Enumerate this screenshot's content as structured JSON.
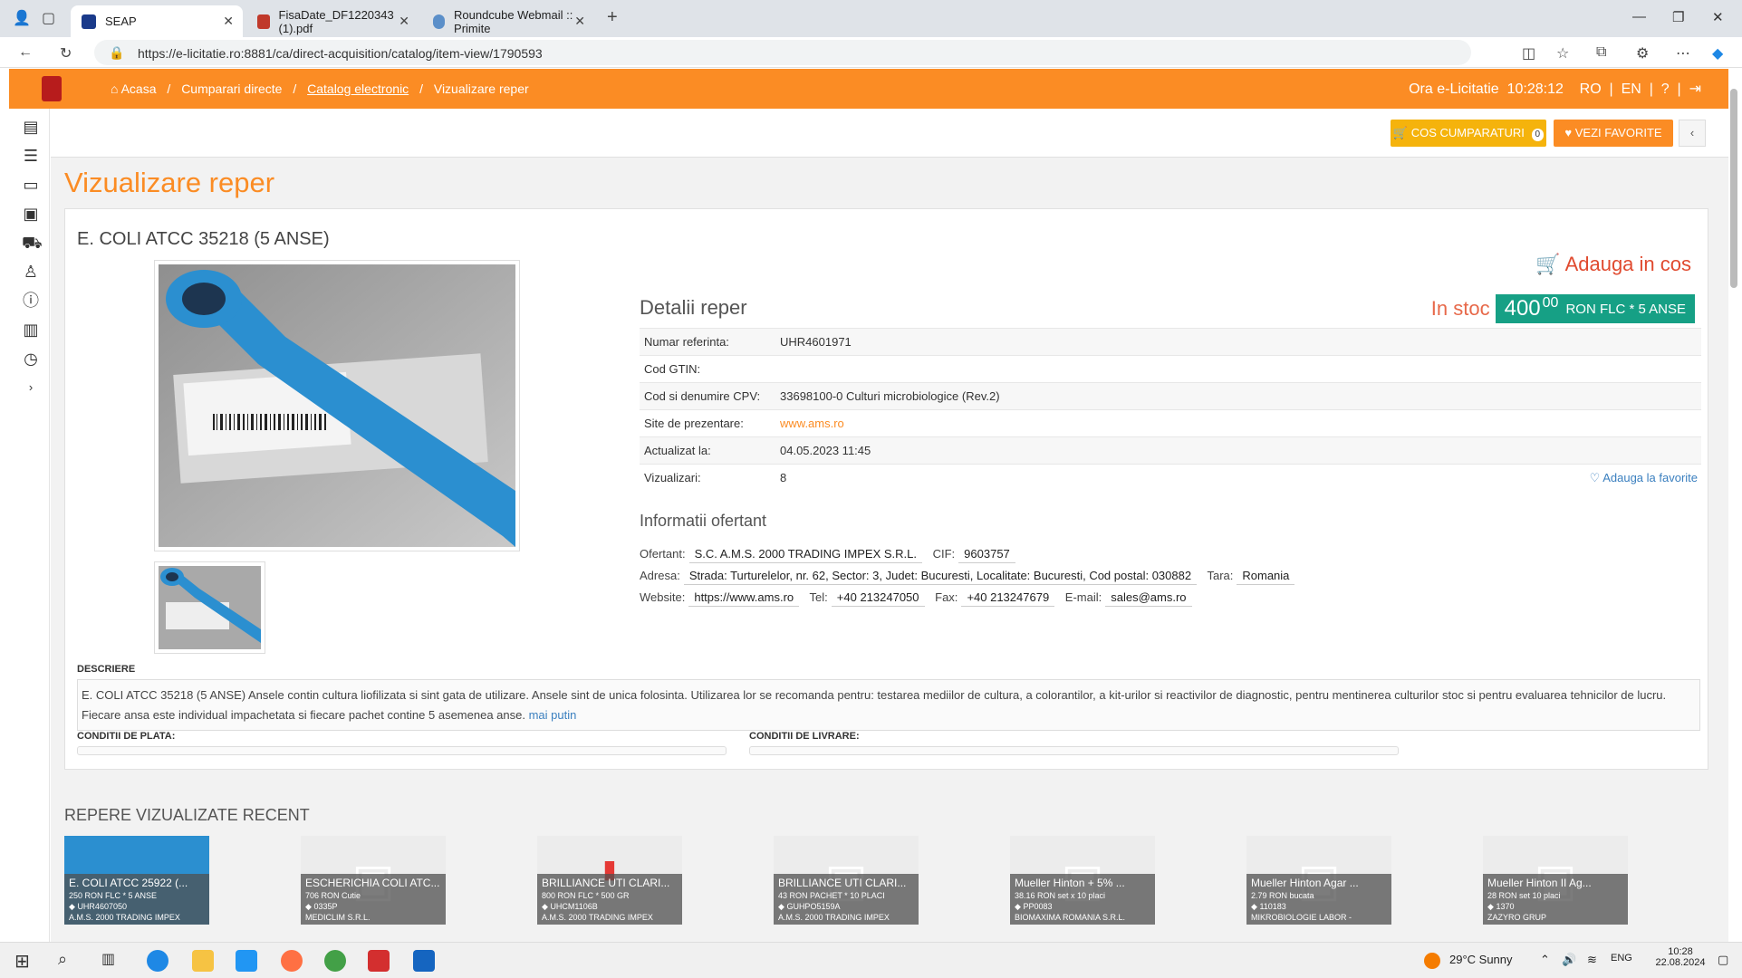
{
  "browser": {
    "tabs": [
      {
        "label": "SEAP"
      },
      {
        "label": "FisaDate_DF1220343 (1).pdf"
      },
      {
        "label": "Roundcube Webmail :: Primite"
      }
    ],
    "url": "https://e-licitatie.ro:8881/ca/direct-acquisition/catalog/item-view/1790593"
  },
  "topbar": {
    "breadcrumb": [
      "Acasa",
      "Cumparari directe",
      "Catalog electronic",
      "Vizualizare reper"
    ],
    "clock_label": "Ora e-Licitatie",
    "clock": "10:28:12",
    "lang_ro": "RO",
    "lang_en": "EN"
  },
  "actions": {
    "cart": "COS CUMPARATURI",
    "cart_count": "0",
    "favorites": "VEZI FAVORITE"
  },
  "page": {
    "title": "Vizualizare reper",
    "product_title": "E. COLI ATCC 35218 (5 ANSE)",
    "add_to_cart": "Adauga in cos",
    "details_heading": "Detalii reper",
    "stock_label": "In stoc",
    "price_int": "400",
    "price_dec": "00",
    "price_unit": "RON FLC * 5 ANSE",
    "details": [
      {
        "k": "Numar referinta:",
        "v": "UHR4601971"
      },
      {
        "k": "Cod GTIN:",
        "v": ""
      },
      {
        "k": "Cod si denumire CPV:",
        "v": "33698100-0 Culturi microbiologice (Rev.2)"
      },
      {
        "k": "Site de prezentare:",
        "v": "www.ams.ro"
      },
      {
        "k": "Actualizat la:",
        "v": "04.05.2023 11:45"
      },
      {
        "k": "Vizualizari:",
        "v": "8"
      }
    ],
    "add_fav": "Adauga la favorite",
    "offer_heading": "Informatii ofertant",
    "offer": {
      "ofertant_l": "Ofertant:",
      "ofertant": "S.C. A.M.S. 2000 TRADING IMPEX S.R.L.",
      "cif_l": "CIF:",
      "cif": "9603757",
      "adresa_l": "Adresa:",
      "adresa": "Strada: Turturelelor, nr. 62, Sector: 3, Judet: Bucuresti, Localitate: Bucuresti, Cod postal: 030882",
      "tara_l": "Tara:",
      "tara": "Romania",
      "web_l": "Website:",
      "web": "https://www.ams.ro",
      "tel_l": "Tel:",
      "tel": "+40 213247050",
      "fax_l": "Fax:",
      "fax": "+40 213247679",
      "email_l": "E-mail:",
      "email": "sales@ams.ro"
    },
    "desc_label": "DESCRIERE",
    "description": "E. COLI ATCC 35218 (5 ANSE) Ansele contin cultura liofilizata si sint gata de utilizare. Ansele sint de unica folosinta. Utilizarea lor se recomanda pentru: testarea mediilor de cultura, a colorantilor, a kit-urilor si reactivilor de diagnostic, pentru mentinerea culturilor stoc si pentru evaluarea tehnicilor de lucru. Fiecare ansa este individual impachetata si fiecare pachet contine 5 asemenea anse.",
    "less": "mai putin",
    "pay_label": "CONDITII DE PLATA:",
    "delivery_label": "CONDITII DE LIVRARE:",
    "recent_heading": "REPERE VIZUALIZATE RECENT"
  },
  "recent": [
    {
      "t": "E. COLI ATCC 25922 (...",
      "p": "250 RON FLC * 5 ANSE",
      "c": "UHR4607050",
      "s": "A.M.S. 2000 TRADING IMPEX"
    },
    {
      "t": "ESCHERICHIA COLI ATC...",
      "p": "706 RON Cutie",
      "c": "0335P",
      "s": "MEDICLIM S.R.L."
    },
    {
      "t": "BRILLIANCE UTI CLARI...",
      "p": "800 RON FLC * 500 GR",
      "c": "UHCM1106B",
      "s": "A.M.S. 2000 TRADING IMPEX"
    },
    {
      "t": "BRILLIANCE UTI CLARI...",
      "p": "43 RON PACHET * 10 PLACI",
      "c": "GUHPO5159A",
      "s": "A.M.S. 2000 TRADING IMPEX"
    },
    {
      "t": "Mueller Hinton + 5% ...",
      "p": "38.16 RON set x 10 placi",
      "c": "PP0083",
      "s": "BIOMAXIMA ROMANIA S.R.L."
    },
    {
      "t": "Mueller Hinton Agar ...",
      "p": "2.79 RON bucata",
      "c": "110183",
      "s": "MIKROBIOLOGIE LABOR -"
    },
    {
      "t": "Mueller Hinton II Ag...",
      "p": "28 RON set 10 placi",
      "c": "1370",
      "s": "ZAZYRO GRUP"
    }
  ],
  "taskbar": {
    "weather": "29°C  Sunny",
    "lang": "ENG",
    "time": "10:28",
    "date": "22.08.2024"
  }
}
